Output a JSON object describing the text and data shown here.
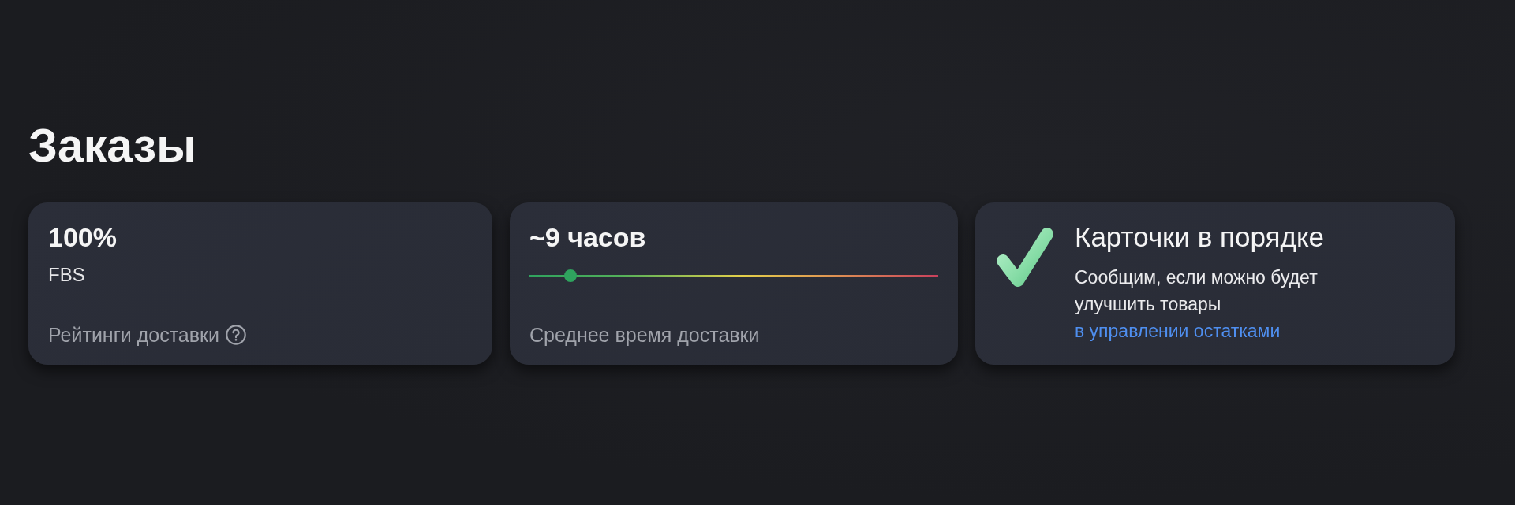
{
  "page_title": "Заказы",
  "cards": [
    {
      "kind": "metric",
      "value": "100%",
      "subtitle": "FBS",
      "label": "Рейтинги доставки"
    },
    {
      "kind": "scale",
      "value": "~9 часов",
      "level": 0.1,
      "label": "Среднее время доставки"
    },
    {
      "kind": "status",
      "title": "Карточки в порядке",
      "text": "Сообщим, если можно будет улучшить товары",
      "link": "в управлении остатками"
    }
  ]
}
